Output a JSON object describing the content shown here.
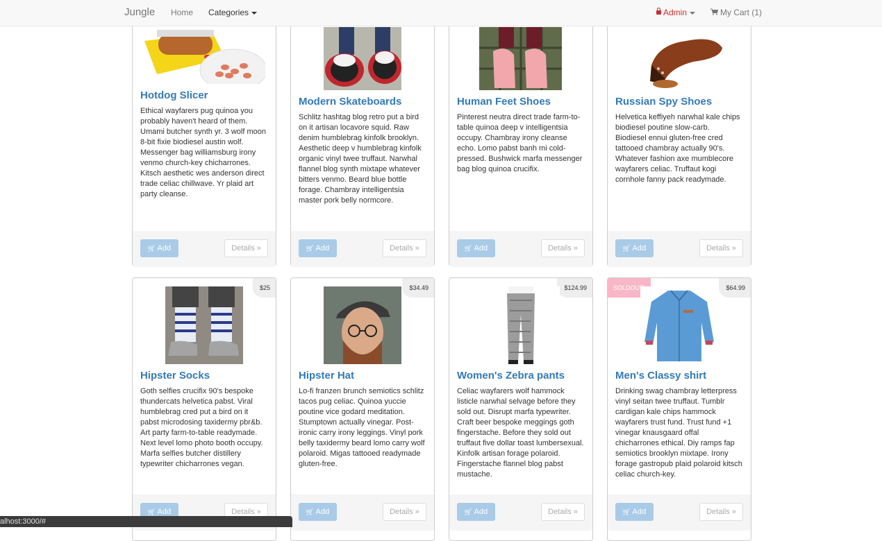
{
  "navbar": {
    "brand": "Jungle",
    "home": "Home",
    "categories": "Categories",
    "admin": "Admin",
    "cart": "My Cart (1)",
    "lock_icon": "lock-icon",
    "cart_icon": "shopping-cart-icon"
  },
  "products": [
    {
      "name": "Hotdog Slicer",
      "price": "",
      "sold_out": "",
      "description": "Ethical wayfarers pug quinoa you probably haven't heard of them. Umami butcher synth yr. 3 wolf moon 8-bit fixie biodiesel austin wolf. Messenger bag williamsburg irony venmo church-key chicharrones. Kitsch aesthetic wes anderson direct trade celiac chillwave. Yr plaid art party cleanse.",
      "add_label": "Add",
      "details_label": "Details »"
    },
    {
      "name": "Modern Skateboards",
      "price": "",
      "sold_out": "",
      "description": "Schlitz hashtag blog retro put a bird on it artisan locavore squid. Raw denim humblebrag kinfolk brooklyn. Aesthetic deep v humblebrag kinfolk organic vinyl twee truffaut. Narwhal flannel blog synth mixtape whatever bitters venmo. Beard blue bottle forage. Chambray intelligentsia master pork belly normcore.",
      "add_label": "Add",
      "details_label": "Details »"
    },
    {
      "name": "Human Feet Shoes",
      "price": "",
      "sold_out": "",
      "description": "Pinterest neutra direct trade farm-to-table quinoa deep v intelligentsia occupy. Chambray irony cleanse echo. Lomo pabst banh mi cold-pressed. Bushwick marfa messenger bag blog quinoa crucifix.",
      "add_label": "Add",
      "details_label": "Details »"
    },
    {
      "name": "Russian Spy Shoes",
      "price": "",
      "sold_out": "",
      "description": "Helvetica keffiyeh narwhal kale chips biodiesel poutine slow-carb. Biodiesel ennui gluten-free cred tattooed chambray actually 90's. Whatever fashion axe mumblecore wayfarers celiac. Truffaut kogi cornhole fanny pack readymade.",
      "add_label": "Add",
      "details_label": "Details »"
    },
    {
      "name": "Hipster Socks",
      "price": "$25",
      "sold_out": "",
      "description": "Goth selfies crucifix 90's bespoke thundercats helvetica pabst. Viral humblebrag cred put a bird on it pabst microdosing taxidermy pbr&b. Art party farm-to-table readymade. Next level lomo photo booth occupy. Marfa selfies butcher distillery typewriter chicharrones vegan.",
      "add_label": "Add",
      "details_label": "Details »"
    },
    {
      "name": "Hipster Hat",
      "price": "$34.49",
      "sold_out": "",
      "description": "Lo-fi franzen brunch semiotics schlitz tacos pug celiac. Quinoa yuccie poutine vice godard meditation. Stumptown actually vinegar. Post-ironic carry irony leggings. Vinyl pork belly taxidermy beard lomo carry wolf polaroid. Migas tattooed readymade gluten-free.",
      "add_label": "Add",
      "details_label": "Details »"
    },
    {
      "name": "Women's Zebra pants",
      "price": "$124.99",
      "sold_out": "",
      "description": "Celiac wayfarers wolf hammock listicle narwhal selvage before they sold out. Disrupt marfa typewriter. Craft beer bespoke meggings goth fingerstache. Before they sold out truffaut five dollar toast lumbersexual. Kinfolk artisan forage polaroid. Fingerstache flannel blog pabst mustache.",
      "add_label": "Add",
      "details_label": "Details »"
    },
    {
      "name": "Men's Classy shirt",
      "price": "$64.99",
      "sold_out": "SOLDOUT!",
      "description": "Drinking swag chambray letterpress vinyl seitan twee truffaut. Tumblr cardigan kale chips hammock wayfarers trust fund. Trust fund +1 vinegar knausgaard offal chicharrones ethical. Diy ramps fap semiotics brooklyn mixtape. Irony forage gastropub plaid polaroid kitsch celiac church-key.",
      "add_label": "Add",
      "details_label": "Details »"
    }
  ],
  "status_bar": {
    "url": "alhost:3000/#"
  }
}
